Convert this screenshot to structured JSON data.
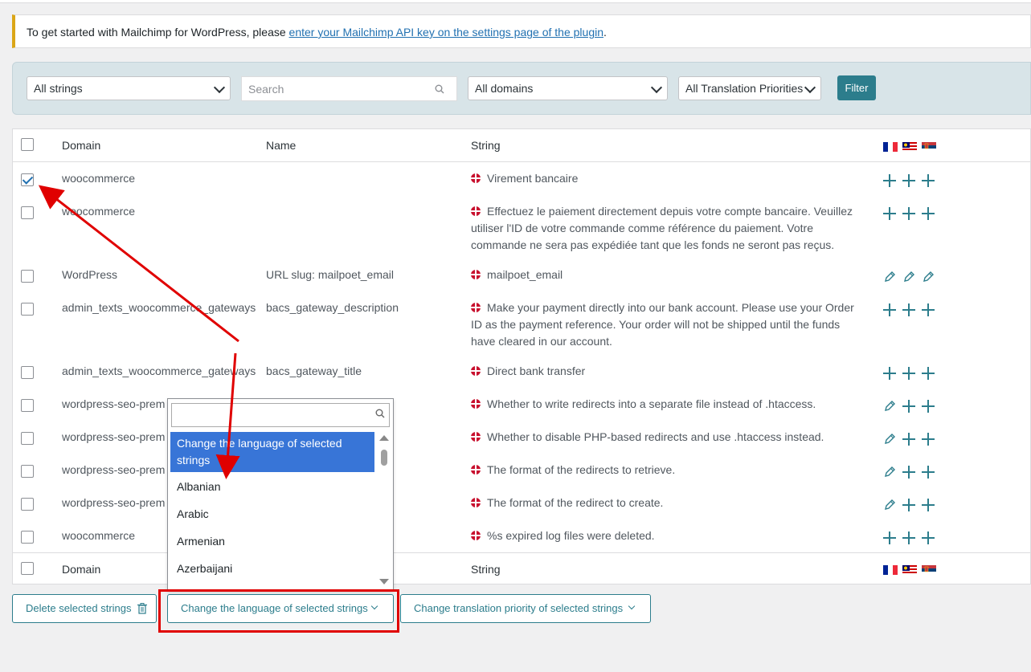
{
  "notice": {
    "prefix": "To get started with Mailchimp for WordPress, please ",
    "link": "enter your Mailchimp API key on the settings page of the plugin",
    "suffix": "."
  },
  "filters": {
    "strings": "All strings",
    "search_placeholder": "Search",
    "domains": "All domains",
    "priorities": "All Translation Priorities",
    "filter_button": "Filter"
  },
  "table": {
    "headers": {
      "domain": "Domain",
      "name": "Name",
      "string": "String"
    },
    "flags": [
      "fr",
      "my",
      "rs"
    ],
    "rows": [
      {
        "checked": true,
        "domain": "woocommerce",
        "name": "",
        "string": "Virement bancaire",
        "actions": [
          "plus",
          "plus",
          "plus"
        ]
      },
      {
        "checked": false,
        "domain": "woocommerce",
        "name": "",
        "string": "Effectuez le paiement directement depuis votre compte bancaire. Veuillez utiliser l'ID de votre commande comme référence du paiement. Votre commande ne sera pas expédiée tant que les fonds ne seront pas reçus.",
        "actions": [
          "plus",
          "plus",
          "plus"
        ]
      },
      {
        "checked": false,
        "domain": "WordPress",
        "name": "URL slug: mailpoet_email",
        "string": "mailpoet_email",
        "actions": [
          "pencil",
          "pencil",
          "pencil"
        ]
      },
      {
        "checked": false,
        "domain": "admin_texts_woocommerce_gateways",
        "name": "bacs_gateway_description",
        "string": "Make your payment directly into our bank account. Please use your Order ID as the payment reference. Your order will not be shipped until the funds have cleared in our account.",
        "actions": [
          "plus",
          "plus",
          "plus"
        ]
      },
      {
        "checked": false,
        "domain": "admin_texts_woocommerce_gateways",
        "name": "bacs_gateway_title",
        "string": "Direct bank transfer",
        "actions": [
          "plus",
          "plus",
          "plus"
        ]
      },
      {
        "checked": false,
        "domain": "wordpress-seo-prem",
        "name": "",
        "string": "Whether to write redirects into a separate file instead of .htaccess.",
        "actions": [
          "pencil",
          "plus",
          "plus"
        ]
      },
      {
        "checked": false,
        "domain": "wordpress-seo-prem",
        "name": "",
        "string": "Whether to disable PHP-based redirects and use .htaccess instead.",
        "actions": [
          "pencil",
          "plus",
          "plus"
        ]
      },
      {
        "checked": false,
        "domain": "wordpress-seo-prem",
        "name": "",
        "string": "The format of the redirects to retrieve.",
        "actions": [
          "pencil",
          "plus",
          "plus"
        ]
      },
      {
        "checked": false,
        "domain": "wordpress-seo-prem",
        "name": "",
        "string": "The format of the redirect to create.",
        "actions": [
          "pencil",
          "plus",
          "plus"
        ]
      },
      {
        "checked": false,
        "domain": "woocommerce",
        "name": "",
        "string": "%s expired log files were deleted.",
        "actions": [
          "plus",
          "plus",
          "plus"
        ]
      }
    ]
  },
  "bulk": {
    "delete": "Delete selected strings",
    "change_language": "Change the language of selected strings",
    "change_priority": "Change translation priority of selected strings"
  },
  "dropdown": {
    "highlighted": "Change the language of selected strings",
    "options": [
      "Albanian",
      "Arabic",
      "Armenian",
      "Azerbaijani"
    ]
  },
  "colors": {
    "accent": "#2c7d8c",
    "highlight": "#3875d7",
    "annotation": "#e00000",
    "notice_border": "#dba617"
  }
}
